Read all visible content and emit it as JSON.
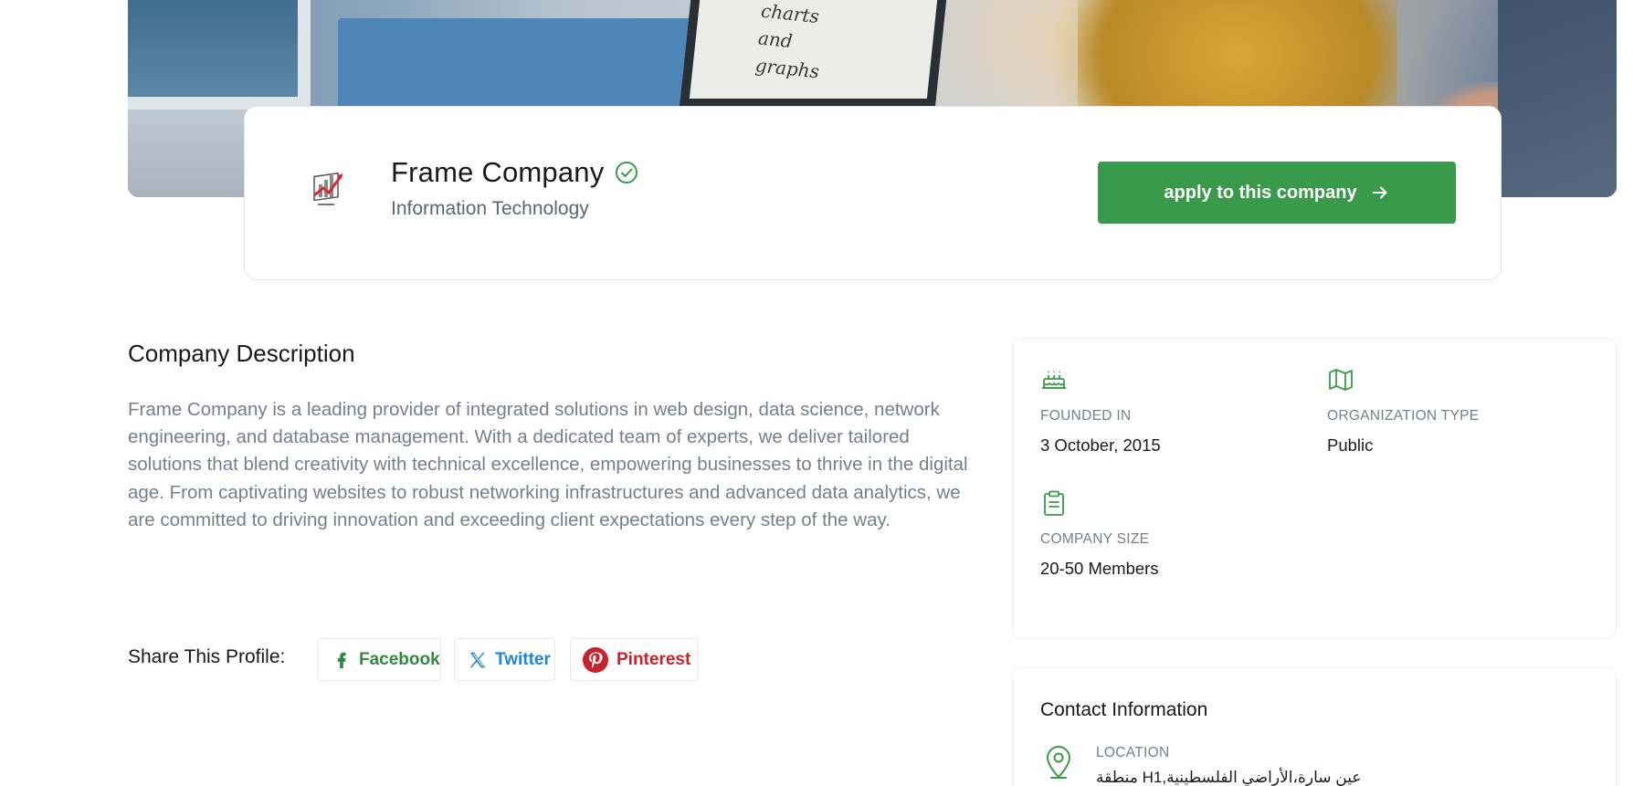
{
  "banner": {
    "laptop_text": [
      "charts",
      "and",
      "graphs"
    ],
    "colors": {
      "accent": "#3a9a4b"
    }
  },
  "header": {
    "company_name": "Frame Company",
    "industry": "Information Technology",
    "verified_icon": "check-circle-icon",
    "apply_label": "apply to this company",
    "apply_icon": "arrow-right-icon"
  },
  "description": {
    "title": "Company Description",
    "text": "Frame Company is a leading provider of integrated solutions in web design, data science, network engineering, and database management. With a dedicated team of experts, we deliver tailored solutions that blend creativity with technical excellence, empowering businesses to thrive in the digital age. From captivating websites to robust networking infrastructures and advanced data analytics, we are committed to driving innovation and exceeding client expectations every step of the way."
  },
  "share": {
    "label": "Share This Profile:",
    "facebook": "Facebook",
    "twitter": "Twitter",
    "pinterest": "Pinterest",
    "colors": {
      "facebook": "#2e8b3e",
      "twitter": "#1e88d8",
      "pinterest": "#c8232c"
    }
  },
  "overview": {
    "founded": {
      "icon": "cake-icon",
      "label": "FOUNDED IN",
      "value": "3 October, 2015"
    },
    "org_type": {
      "icon": "map-icon",
      "label": "ORGANIZATION TYPE",
      "value": "Public"
    },
    "size": {
      "icon": "clipboard-icon",
      "label": "COMPANY SIZE",
      "value": "20-50 Members"
    }
  },
  "contact": {
    "title": "Contact Information",
    "location_label": "LOCATION",
    "location_value": "عين سارة،الأراضي الفلسطينية,H1 منطقة"
  }
}
